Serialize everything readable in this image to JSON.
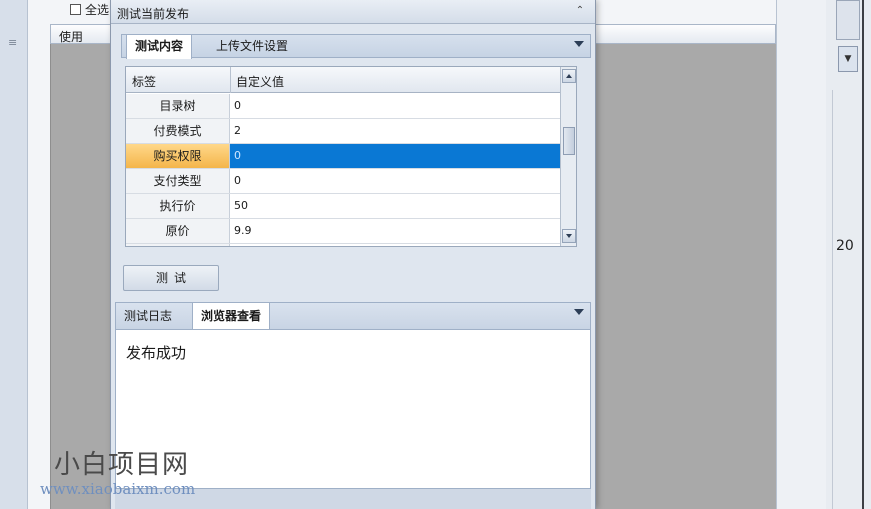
{
  "background": {
    "select_all_label": "全选",
    "column_header": "使用",
    "right_number": "20"
  },
  "dialog": {
    "title": "测试当前发布",
    "tabs": [
      {
        "label": "测试内容",
        "active": true
      },
      {
        "label": "上传文件设置",
        "active": false
      }
    ],
    "grid": {
      "headers": [
        "标签",
        "自定义值"
      ],
      "rows": [
        {
          "key": "目录树",
          "value": "0"
        },
        {
          "key": "付费模式",
          "value": "2"
        },
        {
          "key": "购买权限",
          "value": "0",
          "selected": true
        },
        {
          "key": "支付类型",
          "value": "0"
        },
        {
          "key": "执行价",
          "value": "50"
        },
        {
          "key": "原价",
          "value": "9.9"
        }
      ]
    },
    "test_button": "测试",
    "log_tabs": [
      {
        "label": "测试日志",
        "active": false
      },
      {
        "label": "浏览器查看",
        "active": true
      }
    ],
    "log_message": "发布成功"
  },
  "watermark": {
    "text": "小白项目网",
    "url": "www.xiaobaixm.com"
  },
  "colors": {
    "selection": "#0a78d4",
    "selected_label": "#f4b54a"
  }
}
